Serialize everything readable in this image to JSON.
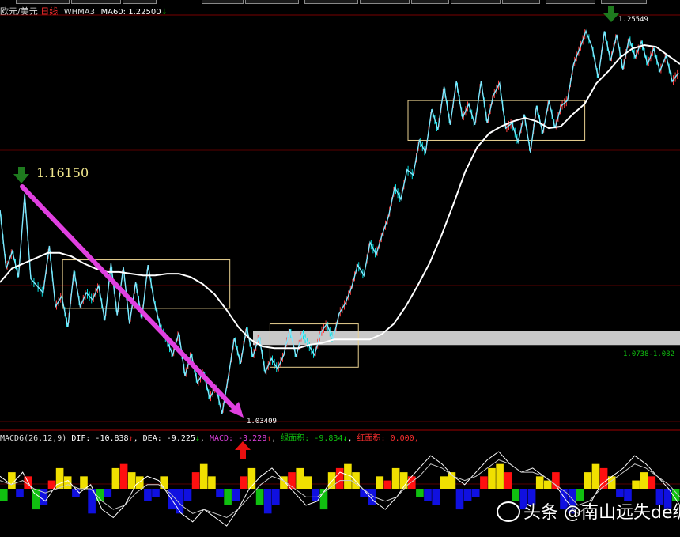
{
  "header": {
    "symbol": "欧元/美元",
    "period": "日线",
    "indicator": "WHMA3",
    "ma_label": "MA60: 1.22500",
    "ma_arrow": "↓"
  },
  "macd_header": {
    "name": "MACD6",
    "params": "(26,12,9)",
    "dif": "DIF: -10.838",
    "dif_arrow": "↑",
    "dea": "DEA: -9.225",
    "dea_arrow": "↓",
    "macd": "MACD: -3.228",
    "macd_arrow": "↑",
    "green_area": "绿面积: -9.834",
    "green_arrow": "↓",
    "red_area": "红面积: 0.000"
  },
  "watermark": "头条 @南山远失de缠",
  "colors": {
    "ma_line": "#ffffff",
    "zigzag": "#7fe8ff",
    "candle_up": "#ff4040",
    "candle_down": "#00e0e0",
    "pivot_box": "#e8d090",
    "zone_band": "#c8c8c8",
    "trend_arrow": "#e040e0",
    "down_marker": "#1e7a1e",
    "up_marker": "#e81010",
    "level_text": "#f0e68c",
    "grid_red": "#5a0000",
    "hist_yellow": "#f0e000",
    "hist_red": "#ff1010",
    "hist_blue": "#1010e0",
    "hist_green": "#10c010"
  },
  "chart_data": {
    "type": "line",
    "price_labels": {
      "high_start": "1.16150",
      "low": "1.03409",
      "high_end": "1.25549",
      "zone": "1.0738-1.082"
    },
    "zigzag": [
      1.152,
      1.118,
      1.128,
      1.113,
      1.161,
      1.112,
      1.108,
      1.104,
      1.131,
      1.096,
      1.102,
      1.084,
      1.117,
      1.096,
      1.104,
      1.1,
      1.108,
      1.088,
      1.121,
      1.091,
      1.119,
      1.086,
      1.11,
      1.089,
      1.12,
      1.099,
      1.084,
      1.077,
      1.068,
      1.081,
      1.056,
      1.069,
      1.052,
      1.058,
      1.043,
      1.05,
      1.034,
      1.055,
      1.078,
      1.063,
      1.084,
      1.067,
      1.079,
      1.058,
      1.066,
      1.06,
      1.068,
      1.083,
      1.067,
      1.081,
      1.074,
      1.068,
      1.081,
      1.086,
      1.077,
      1.092,
      1.098,
      1.107,
      1.12,
      1.114,
      1.133,
      1.126,
      1.138,
      1.148,
      1.165,
      1.158,
      1.175,
      1.172,
      1.192,
      1.185,
      1.21,
      1.198,
      1.223,
      1.201,
      1.226,
      1.205,
      1.213,
      1.201,
      1.226,
      1.202,
      1.218,
      1.225,
      1.199,
      1.202,
      1.191,
      1.207,
      1.185,
      1.212,
      1.196,
      1.215,
      1.199,
      1.212,
      1.215,
      1.236,
      1.245,
      1.255,
      1.246,
      1.228,
      1.255,
      1.238,
      1.253,
      1.233,
      1.251,
      1.24,
      1.249,
      1.236,
      1.245,
      1.232,
      1.241,
      1.226,
      1.231
    ],
    "ma60": [
      1.11,
      1.118,
      1.121,
      1.124,
      1.127,
      1.127,
      1.125,
      1.121,
      1.118,
      1.116,
      1.116,
      1.115,
      1.114,
      1.114,
      1.115,
      1.115,
      1.113,
      1.109,
      1.103,
      1.094,
      1.084,
      1.077,
      1.073,
      1.072,
      1.072,
      1.072,
      1.074,
      1.075,
      1.077,
      1.077,
      1.077,
      1.077,
      1.08,
      1.086,
      1.096,
      1.108,
      1.121,
      1.137,
      1.155,
      1.174,
      1.188,
      1.196,
      1.2,
      1.203,
      1.205,
      1.203,
      1.199,
      1.2,
      1.207,
      1.213,
      1.225,
      1.232,
      1.24,
      1.245,
      1.247,
      1.246,
      1.241,
      1.236
    ],
    "pivot_boxes": [
      {
        "x_start": 0.092,
        "x_end": 0.338,
        "top": 1.123,
        "bottom": 1.095
      },
      {
        "x_start": 0.397,
        "x_end": 0.527,
        "top": 1.086,
        "bottom": 1.061
      },
      {
        "x_start": 0.6,
        "x_end": 0.86,
        "top": 1.215,
        "bottom": 1.192
      }
    ],
    "zone": {
      "low": 1.0738,
      "high": 1.082
    },
    "ylim": [
      1.031,
      1.263
    ],
    "macd": {
      "ylim": [
        -1,
        1
      ],
      "histogram": [
        -0.3,
        0.4,
        -0.2,
        0.3,
        -0.5,
        -0.4,
        0.2,
        0.5,
        0.3,
        -0.2,
        0.3,
        -0.6,
        -0.3,
        -0.2,
        0.5,
        0.6,
        0.4,
        0.3,
        -0.3,
        -0.2,
        0.3,
        -0.5,
        -0.6,
        -0.3,
        0.4,
        0.6,
        0.3,
        -0.2,
        -0.4,
        -0.3,
        0.3,
        0.5,
        -0.4,
        -0.6,
        -0.4,
        0.3,
        0.4,
        0.5,
        0.3,
        -0.3,
        -0.5,
        0.4,
        0.5,
        0.6,
        0.4,
        -0.2,
        -0.4,
        0.3,
        0.2,
        0.5,
        0.4,
        0.3,
        -0.2,
        -0.3,
        -0.4,
        0.3,
        0.4,
        -0.5,
        -0.3,
        -0.2,
        0.3,
        0.5,
        0.6,
        0.4,
        -0.3,
        -0.5,
        -0.4,
        0.3,
        0.2,
        0.4,
        -0.5,
        -0.6,
        -0.3,
        0.4,
        0.6,
        0.5,
        0.3,
        -0.2,
        -0.3,
        0.2,
        0.4,
        0.3,
        -0.4,
        -0.5,
        -0.3
      ],
      "dif": [
        0.3,
        0.1,
        0.4,
        -0.1,
        -0.3,
        0.1,
        0.2,
        -0.1,
        0.1,
        -0.5,
        -0.7,
        -0.4,
        0.1,
        0.3,
        0.2,
        -0.2,
        -0.6,
        -0.8,
        -0.5,
        -0.7,
        -0.9,
        -0.5,
        0.0,
        0.3,
        0.5,
        0.2,
        -0.1,
        -0.4,
        -0.3,
        0.1,
        0.4,
        0.3,
        0.0,
        -0.3,
        -0.5,
        -0.2,
        0.2,
        0.5,
        0.8,
        0.6,
        0.3,
        0.1,
        0.4,
        0.7,
        0.9,
        0.6,
        0.4,
        0.5,
        0.3,
        0.1,
        -0.3,
        -0.6,
        -0.4,
        0.1,
        0.3,
        0.5,
        0.8,
        0.6,
        0.3,
        0.0,
        -0.4
      ],
      "dea": [
        0.2,
        0.1,
        0.2,
        0.0,
        -0.1,
        0.0,
        0.1,
        0.0,
        0.0,
        -0.3,
        -0.5,
        -0.4,
        -0.1,
        0.1,
        0.1,
        -0.1,
        -0.4,
        -0.6,
        -0.5,
        -0.6,
        -0.7,
        -0.5,
        -0.2,
        0.1,
        0.3,
        0.2,
        0.0,
        -0.2,
        -0.2,
        0.0,
        0.2,
        0.2,
        0.0,
        -0.2,
        -0.3,
        -0.2,
        0.1,
        0.3,
        0.6,
        0.5,
        0.3,
        0.2,
        0.3,
        0.5,
        0.7,
        0.6,
        0.4,
        0.4,
        0.3,
        0.1,
        -0.1,
        -0.4,
        -0.3,
        0.0,
        0.2,
        0.4,
        0.6,
        0.5,
        0.3,
        0.1,
        -0.2
      ]
    }
  }
}
